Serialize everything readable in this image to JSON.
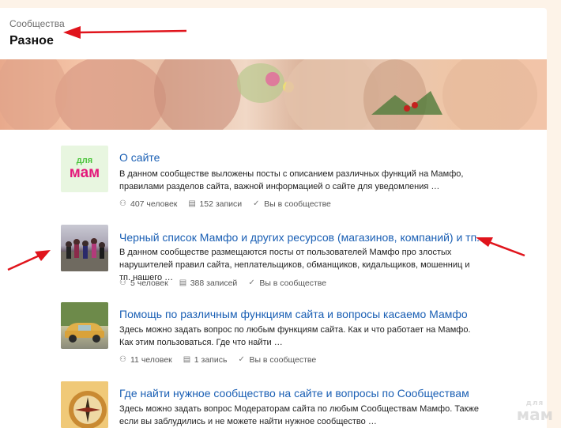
{
  "header": {
    "breadcrumb": "Сообщества",
    "title": "Разное"
  },
  "communities": [
    {
      "title": "О сайте",
      "description": "В данном сообществе выложены посты с описанием различных функций на Мамфо, правилами разделов сайта, важной информацией о сайте для уведомления …",
      "members": "407 человек",
      "posts": "152 записи",
      "membership": "Вы в сообществе",
      "logo_top": "для",
      "logo_bottom": "мам"
    },
    {
      "title": "Черный список Мамфо и других ресурсов (магазинов, компаний) и тп.",
      "description": "В данном сообществе размещаются посты от пользователей Мамфо про злостых нарушителей правил сайта, неплательщиков, обманщиков, кидальщиков, мошенниц и тп. нашего …",
      "members": "5 человек",
      "posts": "388 записей",
      "membership": "Вы в сообществе"
    },
    {
      "title": "Помощь по различным функциям сайта и вопросы касаемо Мамфо",
      "description": "Здесь можно задать вопрос по любым функциям сайта. Как и что работает на Мамфо. Как этим пользоваться. Где что найти …",
      "members": "11 человек",
      "posts": "1 запись",
      "membership": "Вы в сообществе"
    },
    {
      "title": "Где найти нужное сообщество на сайте и вопросы по Сообществам",
      "description": "Здесь можно задать вопрос Модераторам сайта по любым Сообществам Мамфо. Также если вы заблудились и не можете найти нужное сообщество …"
    }
  ],
  "watermark": {
    "top": "для",
    "bottom": "мам"
  },
  "colors": {
    "link": "#1a5fb4",
    "arrow": "#e0141c",
    "logo_bg": "#e8f6e0",
    "logo_green": "#4cc43c",
    "logo_pink": "#e3197b"
  }
}
